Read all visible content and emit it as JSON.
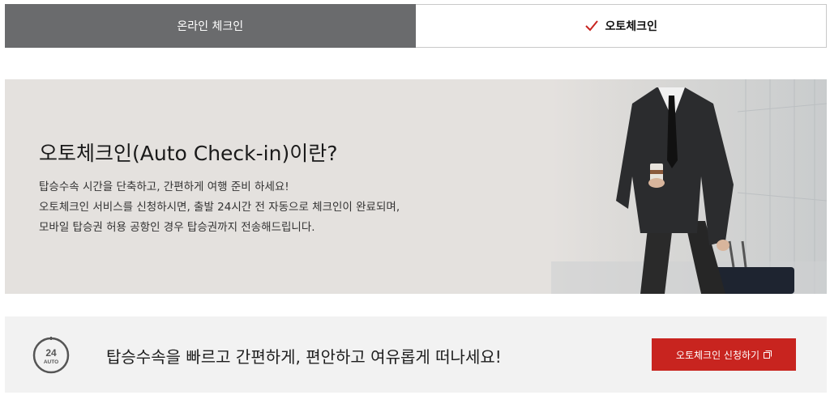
{
  "tabs": [
    {
      "label": "온라인 체크인",
      "active": false
    },
    {
      "label": "오토체크인",
      "active": true
    }
  ],
  "hero": {
    "title": "오토체크인(Auto Check-in)이란?",
    "description": [
      "탑승수속 시간을 단축하고, 간편하게 여행 준비 하세요!",
      "오토체크인 서비스를 신청하시면, 출발 24시간 전 자동으로 체크인이 완료되며,",
      "모바일 탑승권 허용 공항인 경우 탑승권까지 전송해드립니다."
    ]
  },
  "promo": {
    "icon": "clock-24-auto-icon",
    "icon_text_top": "24",
    "icon_text_bottom": "AUTO",
    "message": "탑승수속을 빠르고 간편하게, 편안하고 여유롭게 떠나세요!",
    "button_label": "오토체크인 신청하기"
  },
  "colors": {
    "tab_inactive_bg": "#6a6b6d",
    "hero_bg": "#e4e1de",
    "accent_red": "#c8241f",
    "promo_bg": "#f2f2f2"
  }
}
